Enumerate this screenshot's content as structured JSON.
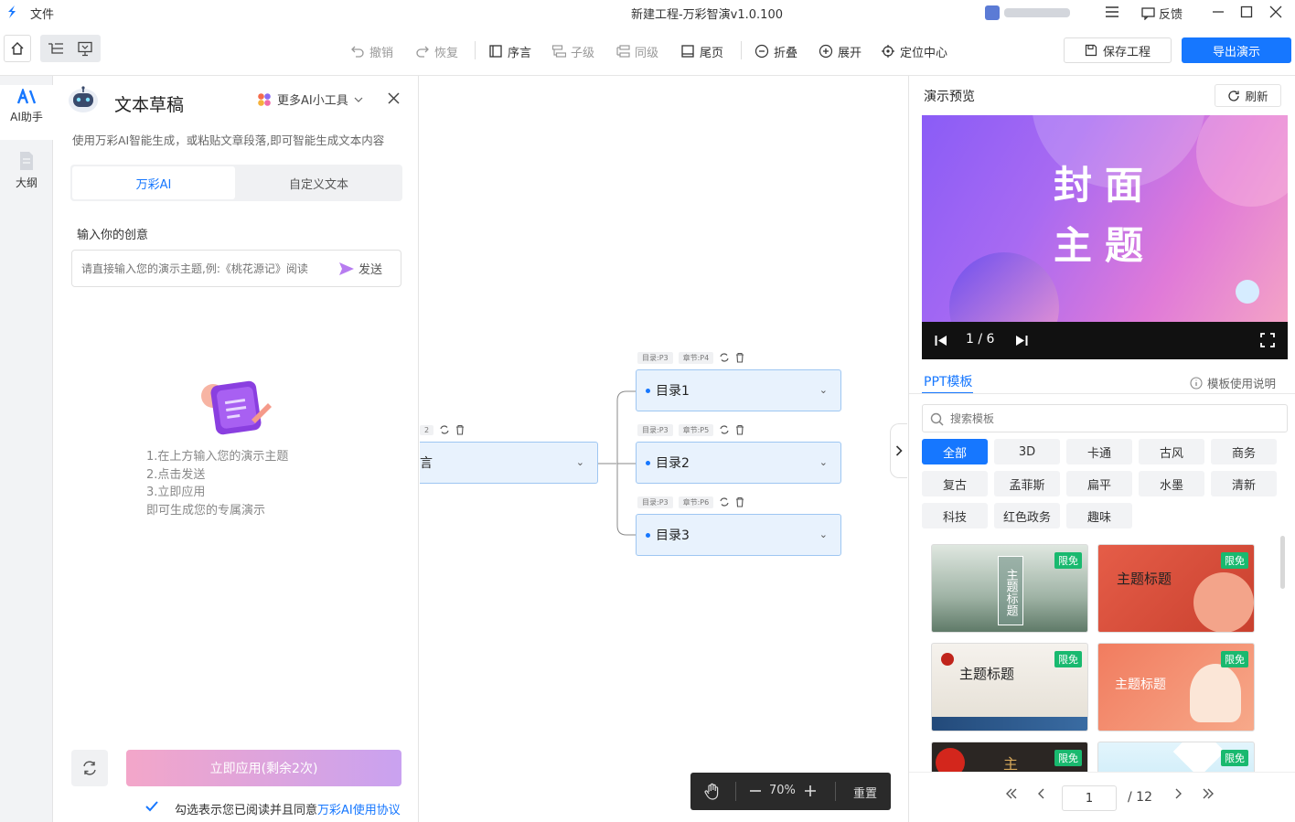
{
  "titlebar": {
    "menu_file": "文件",
    "title": "新建工程-万彩智演v1.0.100",
    "feedback": "反馈"
  },
  "toolbar": {
    "undo": "撤销",
    "redo": "恢复",
    "preface": "序言",
    "child": "子级",
    "sibling": "同级",
    "ending": "尾页",
    "collapse": "折叠",
    "expand": "展开",
    "center": "定位中心",
    "save": "保存工程",
    "export": "导出演示"
  },
  "rail": {
    "ai_label": "AI助手",
    "outline_label": "大纲"
  },
  "draft": {
    "title": "文本草稿",
    "more_tools": "更多AI小工具",
    "description": "使用万彩AI智能生成，或粘贴文章段落,即可智能生成文本内容",
    "tab_ai": "万彩AI",
    "tab_custom": "自定义文本",
    "input_label": "输入你的创意",
    "input_placeholder": "请直接输入您的演示主题,例:《桃花源记》阅读",
    "send": "发送",
    "steps": [
      "1.在上方输入您的演示主题",
      "2.点击发送",
      "3.立即应用",
      "即可生成您的专属演示"
    ],
    "apply": "立即应用(剩余2次)",
    "agree_prefix": "勾选表示您已阅读并且同意",
    "agree_link": "万彩AI使用协议",
    "agree_checked": true
  },
  "canvas": {
    "root_label": "言",
    "root_meta": "2",
    "nodes": [
      {
        "label": "目录1",
        "meta1": "目录:P3",
        "meta2": "章节:P4"
      },
      {
        "label": "目录2",
        "meta1": "目录:P3",
        "meta2": "章节:P5"
      },
      {
        "label": "目录3",
        "meta1": "目录:P3",
        "meta2": "章节:P6"
      }
    ],
    "zoom": "70%",
    "reset": "重置"
  },
  "preview": {
    "title": "演示预览",
    "refresh": "刷新",
    "slide_title_line1": "封面",
    "slide_title_line2": "主题",
    "page_indicator": "1 / 6"
  },
  "templates": {
    "tab": "PPT模板",
    "help": "模板使用说明",
    "search_placeholder": "搜索模板",
    "categories": [
      "全部",
      "3D",
      "卡通",
      "古风",
      "商务",
      "复古",
      "孟菲斯",
      "扁平",
      "水墨",
      "清新",
      "科技",
      "红色政务",
      "趣味"
    ],
    "selected_category": "全部",
    "badge": "限免",
    "cards": [
      {
        "text": "主题标题",
        "colors": [
          "#cfd9d0",
          "#7f9a88"
        ]
      },
      {
        "text": "主题标题",
        "colors": [
          "#e05a45",
          "#c9412f"
        ]
      },
      {
        "text": "主题标题",
        "colors": [
          "#f4f1ec",
          "#e2ddd4"
        ]
      },
      {
        "text": "主题标题",
        "colors": [
          "#f2866a",
          "#f7b08f"
        ]
      },
      {
        "text": "主",
        "colors": [
          "#2b2623",
          "#3b3430"
        ]
      },
      {
        "text": "",
        "colors": [
          "#d9f1fb",
          "#b8e3f6"
        ]
      }
    ],
    "page_current": "1",
    "page_total": "/ 12"
  },
  "colors": {
    "accent": "#1677ff",
    "apply_gradient_start": "#f3a6c9",
    "apply_gradient_end": "#c9a2f0",
    "badge": "#19b96f"
  }
}
